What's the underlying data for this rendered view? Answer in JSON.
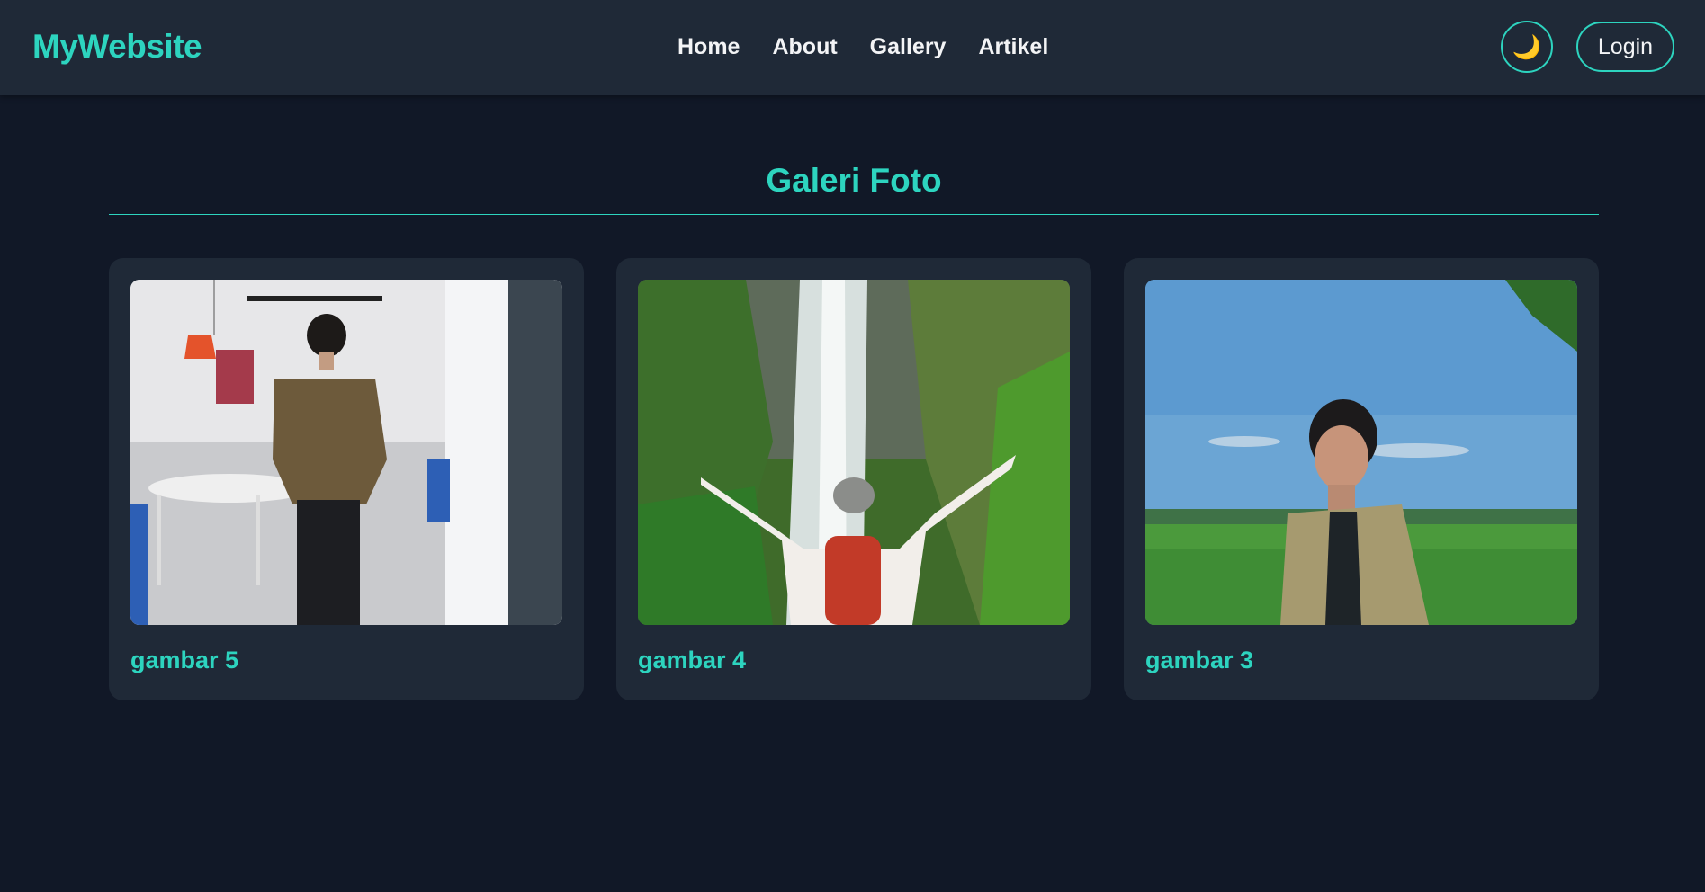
{
  "header": {
    "brand": "MyWebsite",
    "nav": [
      {
        "label": "Home"
      },
      {
        "label": "About"
      },
      {
        "label": "Gallery"
      },
      {
        "label": "Artikel"
      }
    ],
    "theme_icon": "moon-icon",
    "theme_glyph": "🌙",
    "login_label": "Login"
  },
  "main": {
    "title": "Galeri Foto",
    "photos": [
      {
        "caption": "gambar 5",
        "icon": "photo-man-indoor-cafe"
      },
      {
        "caption": "gambar 4",
        "icon": "photo-waterfall-hiker"
      },
      {
        "caption": "gambar 3",
        "icon": "photo-man-field-sky"
      }
    ]
  },
  "colors": {
    "accent": "#2dd4bf",
    "background": "#111827",
    "surface": "#1f2937"
  }
}
